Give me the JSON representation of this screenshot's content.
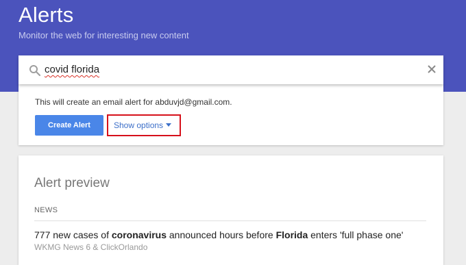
{
  "header": {
    "title": "Alerts",
    "subtitle": "Monitor the web for interesting new content"
  },
  "search": {
    "query": "covid florida",
    "icon": "search-icon",
    "clear_icon": "close-icon"
  },
  "create": {
    "info": "This will create an email alert for abduvjd@gmail.com.",
    "create_button": "Create Alert",
    "show_options": "Show options",
    "caret_icon": "caret-down-icon"
  },
  "preview": {
    "title": "Alert preview",
    "section": "NEWS",
    "article": {
      "part1": "777 new cases of ",
      "bold1": "coronavirus",
      "part2": " announced hours before ",
      "bold2": "Florida",
      "part3": " enters 'full phase one'",
      "source": "WKMG News 6 & ClickOrlando"
    }
  },
  "colors": {
    "header_bg": "#4b53bc",
    "button_bg": "#4a86e8",
    "highlight_border": "#d6101a",
    "link": "#3c6fc8"
  }
}
